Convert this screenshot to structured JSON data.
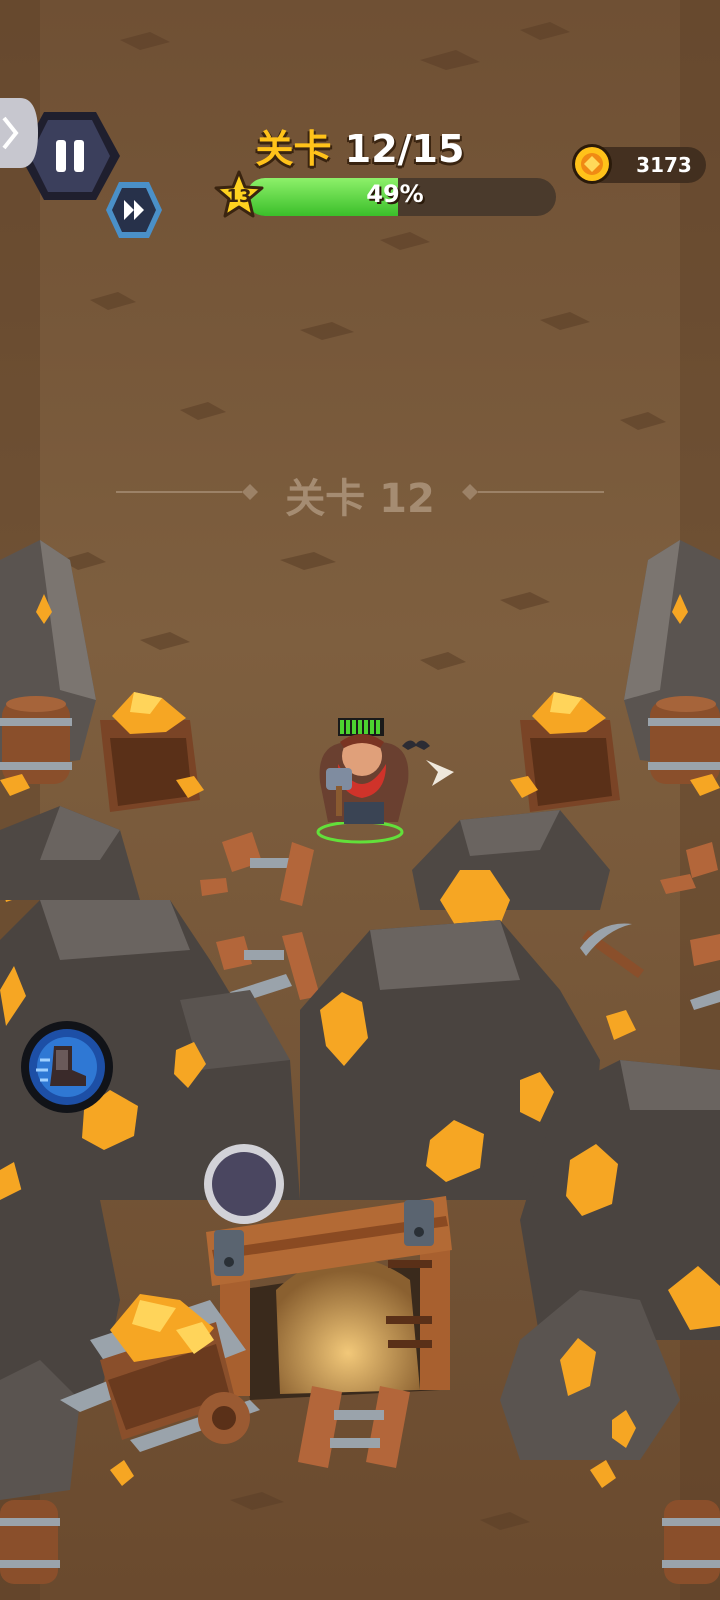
{
  "hud": {
    "level_label": "关卡",
    "level_progress": "12/15",
    "player_level": "13",
    "progress_percent_text": "49%",
    "progress_fraction": 0.49,
    "coins": "3173"
  },
  "stage_banner": {
    "label": "关卡",
    "number": "12"
  },
  "icons": {
    "pause": "pause-icon",
    "fast_forward": "fast-forward-icon",
    "coin": "coin-icon",
    "star": "star-icon",
    "skill": "boot-dash-icon",
    "joystick": "joystick-icon"
  },
  "colors": {
    "gold": "#ffc21a",
    "progress_green": "#3bbf2a",
    "dirt": "#7a5a3a"
  }
}
